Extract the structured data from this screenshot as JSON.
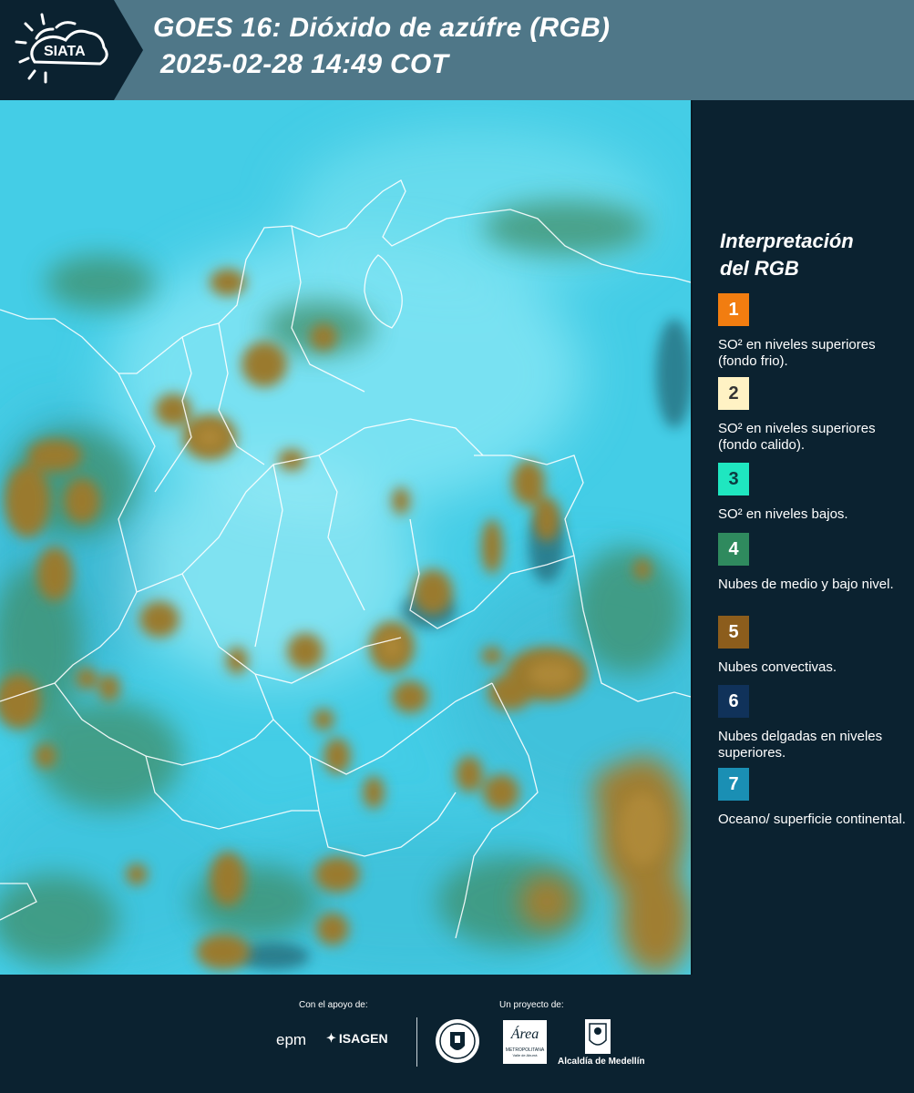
{
  "header": {
    "logo_text": "SIATA",
    "title_line1": "GOES 16: Dióxido de azúfre (RGB)",
    "title_line2": "2025-02-28 14:49 COT"
  },
  "legend": {
    "title_line1": "Interpretación",
    "title_line2": "del RGB",
    "items": [
      {
        "number": "1",
        "label": "SO² en niveles superiores (fondo frio).",
        "color": "#f27d10",
        "text_color": "#ffffff"
      },
      {
        "number": "2",
        "label": "SO² en niveles superiores (fondo calido).",
        "color": "#fff2c4",
        "text_color": "#333333"
      },
      {
        "number": "3",
        "label": "SO² en niveles bajos.",
        "color": "#1fe6c0",
        "text_color": "#0b3a40"
      },
      {
        "number": "4",
        "label": "Nubes de medio y bajo nivel.",
        "color": "#2f8a5e",
        "text_color": "#ffffff"
      },
      {
        "number": "5",
        "label": "Nubes convectivas.",
        "color": "#8c5d1c",
        "text_color": "#ffffff"
      },
      {
        "number": "6",
        "label": "Nubes delgadas en niveles superiores.",
        "color": "#10325a",
        "text_color": "#ffffff"
      },
      {
        "number": "7",
        "label": "Oceano/ superficie continental.",
        "color": "#1a8fb4",
        "text_color": "#ffffff"
      }
    ]
  },
  "footer": {
    "support_label": "Con el apoyo de:",
    "project_label": "Un proyecto de:",
    "sponsor_epm": "epm",
    "sponsor_isagen": "ISAGEN",
    "partner_area": "Área",
    "partner_area_sub": "METROPOLITANA",
    "partner_area_sub2": "Valle de Aburrá",
    "partner_alcaldia": "Alcaldía de Medellín"
  },
  "colors": {
    "header_bg": "#4f7788",
    "panel_bg": "#0b2230",
    "sky_cyan": "#4fd7ef",
    "cloud_brown": "#9a7a2e"
  }
}
